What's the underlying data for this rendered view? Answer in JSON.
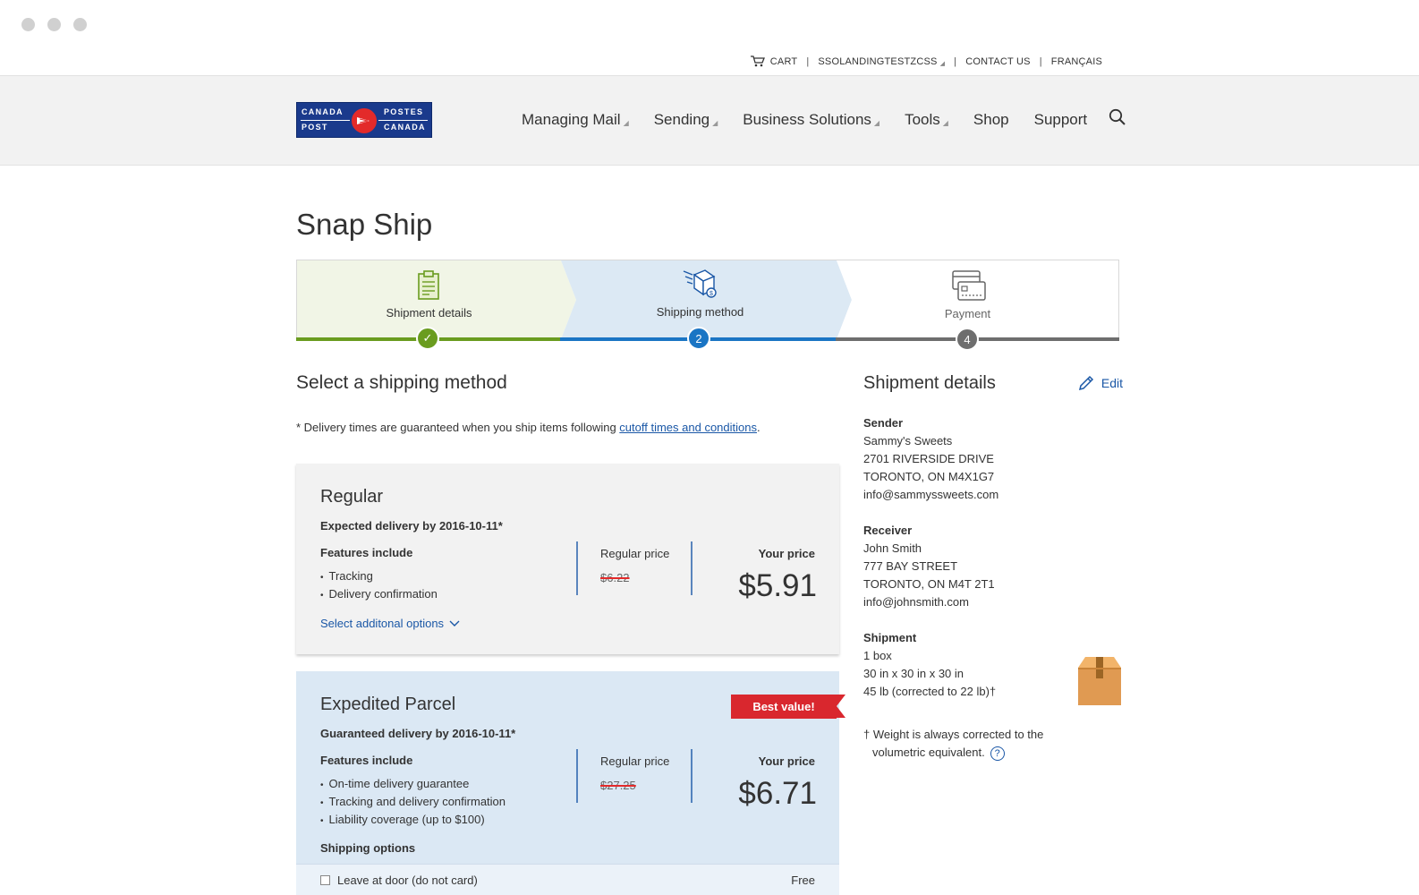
{
  "utility": {
    "cart": "CART",
    "account": "SSOLANDINGTESTZCSS",
    "contact": "CONTACT US",
    "language": "FRANÇAIS"
  },
  "logo": {
    "canada": "CANADA",
    "post": "POST",
    "postes": "POSTES",
    "canada_fr": "CANADA"
  },
  "nav": {
    "items": [
      "Managing Mail",
      "Sending",
      "Business Solutions",
      "Tools",
      "Shop",
      "Support"
    ]
  },
  "page": {
    "title": "Snap Ship"
  },
  "stepper": {
    "steps": [
      {
        "label": "Shipment details",
        "marker": "✓",
        "state": "complete",
        "color": "#6a9c1f"
      },
      {
        "label": "Shipping method",
        "marker": "2",
        "state": "current",
        "color": "#1a75c4"
      },
      {
        "label": "Payment",
        "marker": "4",
        "state": "upcoming",
        "color": "#6e6e6e"
      }
    ]
  },
  "shipping": {
    "title": "Select a shipping method",
    "note_prefix": "* Delivery times are guaranteed when you ship items following ",
    "note_link": "cutoff times and conditions",
    "note_suffix": "."
  },
  "options": {
    "regular": {
      "name": "Regular",
      "delivery": "Expected delivery by 2016-10-11*",
      "features_title": "Features include",
      "features": [
        "Tracking",
        "Delivery confirmation"
      ],
      "regular_label": "Regular price",
      "regular_price": "$6.22",
      "your_label": "Your price",
      "your_price": "$5.91",
      "more_link": "Select additonal options"
    },
    "expedited": {
      "name": "Expedited Parcel",
      "delivery": "Guaranteed delivery by 2016-10-11*",
      "features_title": "Features include",
      "features": [
        "On-time delivery guarantee",
        "Tracking and delivery confirmation",
        "Liability coverage (up to $100)"
      ],
      "regular_label": "Regular price",
      "regular_price": "$27.25",
      "your_label": "Your price",
      "your_price": "$6.71",
      "badge": "Best value!",
      "shipping_options_title": "Shipping options",
      "option_label": "Leave at door (do not card)",
      "option_price": "Free"
    }
  },
  "details": {
    "title": "Shipment details",
    "edit": "Edit",
    "sender": {
      "label": "Sender",
      "lines": [
        "Sammy's Sweets",
        "2701 RIVERSIDE DRIVE",
        "TORONTO, ON M4X1G7",
        "info@sammyssweets.com"
      ]
    },
    "receiver": {
      "label": "Receiver",
      "lines": [
        "John Smith",
        "777 BAY STREET",
        "TORONTO, ON M4T 2T1",
        "info@johnsmith.com"
      ]
    },
    "shipment": {
      "label": "Shipment",
      "lines": [
        "1 box",
        "30 in x 30 in x 30 in",
        "45 lb (corrected to 22 lb)†"
      ]
    },
    "footnote_line1": "† Weight is always corrected to the",
    "footnote_line2": "volumetric equivalent.",
    "help": "?"
  }
}
